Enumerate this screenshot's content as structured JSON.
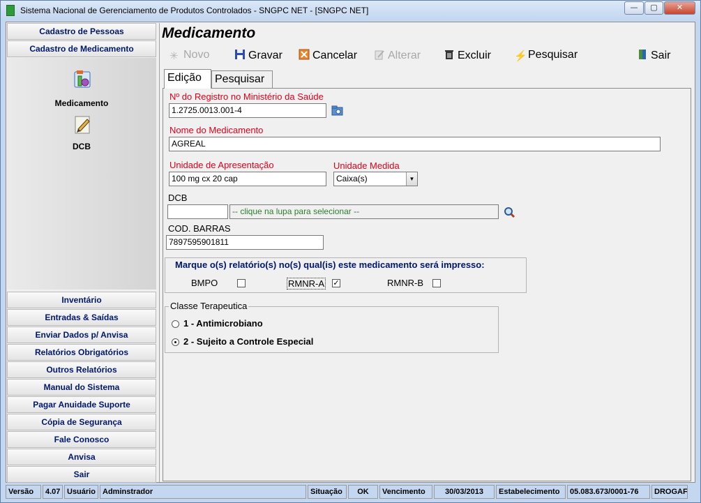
{
  "window": {
    "title": "Sistema Nacional de Gerenciamento de Produtos Controlados - SNGPC NET - [SNGPC NET]"
  },
  "sidebar": {
    "headers": [
      "Cadastro de Pessoas",
      "Cadastro de Medicamento"
    ],
    "items": [
      {
        "label": "Medicamento",
        "icon": "medicine-icon"
      },
      {
        "label": "DCB",
        "icon": "pen-icon"
      }
    ],
    "buttons": [
      "Inventário",
      "Entradas & Saídas",
      "Enviar Dados p/ Anvisa",
      "Relatórios Obrigatórios",
      "Outros Relatórios",
      "Manual do Sistema",
      "Pagar Anuidade Suporte",
      "Cópia de Segurança",
      "Fale Conosco",
      "Anvisa",
      "Sair"
    ]
  },
  "page": {
    "title": "Medicamento"
  },
  "toolbar": {
    "novo": "Novo",
    "gravar": "Gravar",
    "cancelar": "Cancelar",
    "alterar": "Alterar",
    "excluir": "Excluir",
    "pesquisar": "Pesquisar",
    "sair": "Sair"
  },
  "tabs": [
    "Edição",
    "Pesquisar"
  ],
  "form": {
    "registro_label": "Nº do Registro no Ministério da Saúde",
    "registro_value": "1.2725.0013.001-4",
    "nome_label": "Nome do Medicamento",
    "nome_value": "AGREAL",
    "apresentacao_label": "Unidade de Apresentação",
    "apresentacao_value": "100 mg cx 20 cap",
    "medida_label": "Unidade Medida",
    "medida_value": "Caixa(s)",
    "dcb_label": "DCB",
    "dcb_code": "",
    "dcb_hint": "-- clique na lupa para selecionar --",
    "barras_label": "COD. BARRAS",
    "barras_value": "7897595901811"
  },
  "relatorios": {
    "title": "Marque o(s) relatório(s) no(s) qual(is) este medicamento será impresso:",
    "options": [
      {
        "label": "BMPO",
        "checked": false
      },
      {
        "label": "RMNR-A",
        "checked": true
      },
      {
        "label": "RMNR-B",
        "checked": false
      }
    ]
  },
  "classe": {
    "title": "Classe Terapeutica",
    "options": [
      {
        "label": "1 - Antimicrobiano",
        "selected": false
      },
      {
        "label": "2 - Sujeito a Controle Especial",
        "selected": true
      }
    ]
  },
  "status": {
    "versao_label": "Versão",
    "versao": "4.07",
    "usuario_label": "Usuário",
    "usuario": "Adminstrador",
    "situacao_label": "Situação",
    "situacao": "OK",
    "vencimento_label": "Vencimento",
    "vencimento": "30/03/2013",
    "estabelecimento_label": "Estabelecimento",
    "cnpj": "05.083.673/0001-76",
    "estabelecimento": "DROGAF"
  },
  "colors": {
    "red_label": "#e0001b",
    "nav_text": "#00186b",
    "hint_text": "#2d7d2d"
  }
}
